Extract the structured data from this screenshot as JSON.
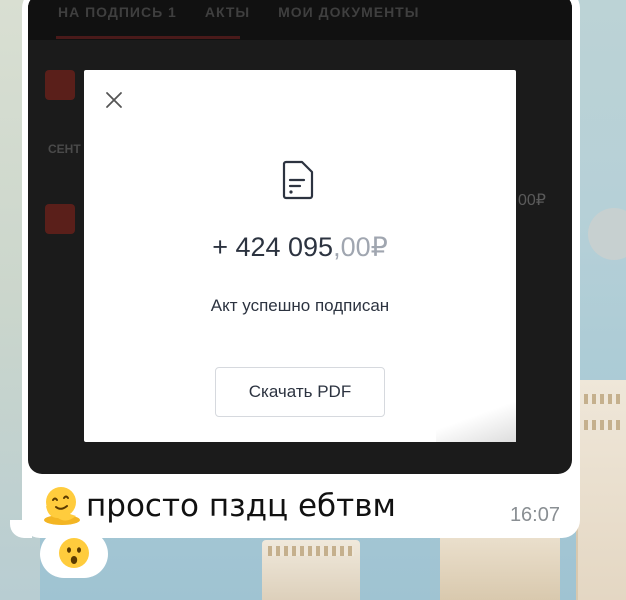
{
  "screenshot": {
    "tabs": [
      "НА ПОДПИСЬ 1",
      "АКТЫ",
      "МОИ ДОКУМЕНТЫ"
    ],
    "row_label_fragment": "СЕНТ",
    "amount_fragment": "00₽"
  },
  "modal": {
    "amount_main": "+ 424 095",
    "amount_cents": ",00",
    "currency": "₽",
    "status": "Акт успешно подписан",
    "download_button": "Скачать PDF"
  },
  "message": {
    "text": "просто пздц ебтвм",
    "time": "16:07"
  },
  "icons": {
    "close": "close-icon",
    "document": "document-icon",
    "melting_face": "melting-face-emoji",
    "reaction": "astonished-face-emoji"
  },
  "colors": {
    "text_dark": "#2c3340",
    "text_muted": "#a0a6b0",
    "bubble": "#ffffff",
    "time": "#8a8f93"
  }
}
